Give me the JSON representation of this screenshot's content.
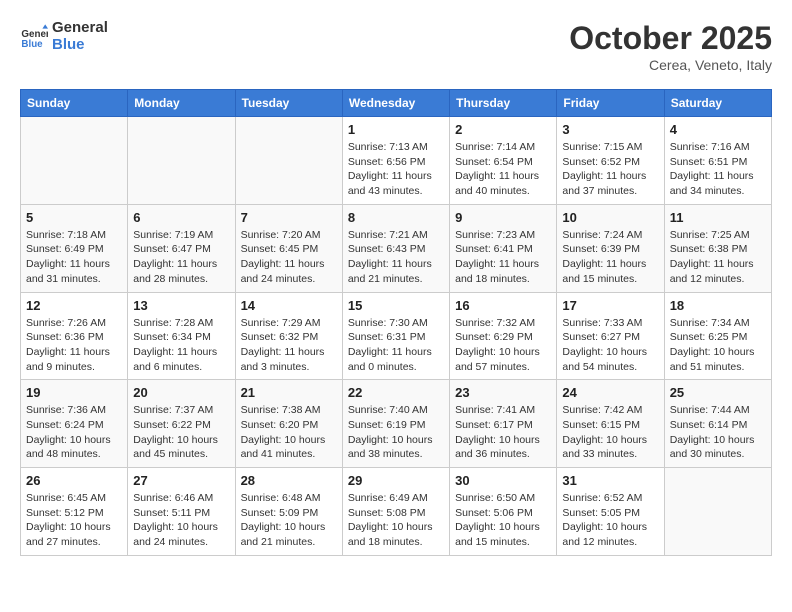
{
  "header": {
    "logo_line1": "General",
    "logo_line2": "Blue",
    "month": "October 2025",
    "location": "Cerea, Veneto, Italy"
  },
  "weekdays": [
    "Sunday",
    "Monday",
    "Tuesday",
    "Wednesday",
    "Thursday",
    "Friday",
    "Saturday"
  ],
  "weeks": [
    [
      {
        "day": "",
        "info": ""
      },
      {
        "day": "",
        "info": ""
      },
      {
        "day": "",
        "info": ""
      },
      {
        "day": "1",
        "info": "Sunrise: 7:13 AM\nSunset: 6:56 PM\nDaylight: 11 hours and 43 minutes."
      },
      {
        "day": "2",
        "info": "Sunrise: 7:14 AM\nSunset: 6:54 PM\nDaylight: 11 hours and 40 minutes."
      },
      {
        "day": "3",
        "info": "Sunrise: 7:15 AM\nSunset: 6:52 PM\nDaylight: 11 hours and 37 minutes."
      },
      {
        "day": "4",
        "info": "Sunrise: 7:16 AM\nSunset: 6:51 PM\nDaylight: 11 hours and 34 minutes."
      }
    ],
    [
      {
        "day": "5",
        "info": "Sunrise: 7:18 AM\nSunset: 6:49 PM\nDaylight: 11 hours and 31 minutes."
      },
      {
        "day": "6",
        "info": "Sunrise: 7:19 AM\nSunset: 6:47 PM\nDaylight: 11 hours and 28 minutes."
      },
      {
        "day": "7",
        "info": "Sunrise: 7:20 AM\nSunset: 6:45 PM\nDaylight: 11 hours and 24 minutes."
      },
      {
        "day": "8",
        "info": "Sunrise: 7:21 AM\nSunset: 6:43 PM\nDaylight: 11 hours and 21 minutes."
      },
      {
        "day": "9",
        "info": "Sunrise: 7:23 AM\nSunset: 6:41 PM\nDaylight: 11 hours and 18 minutes."
      },
      {
        "day": "10",
        "info": "Sunrise: 7:24 AM\nSunset: 6:39 PM\nDaylight: 11 hours and 15 minutes."
      },
      {
        "day": "11",
        "info": "Sunrise: 7:25 AM\nSunset: 6:38 PM\nDaylight: 11 hours and 12 minutes."
      }
    ],
    [
      {
        "day": "12",
        "info": "Sunrise: 7:26 AM\nSunset: 6:36 PM\nDaylight: 11 hours and 9 minutes."
      },
      {
        "day": "13",
        "info": "Sunrise: 7:28 AM\nSunset: 6:34 PM\nDaylight: 11 hours and 6 minutes."
      },
      {
        "day": "14",
        "info": "Sunrise: 7:29 AM\nSunset: 6:32 PM\nDaylight: 11 hours and 3 minutes."
      },
      {
        "day": "15",
        "info": "Sunrise: 7:30 AM\nSunset: 6:31 PM\nDaylight: 11 hours and 0 minutes."
      },
      {
        "day": "16",
        "info": "Sunrise: 7:32 AM\nSunset: 6:29 PM\nDaylight: 10 hours and 57 minutes."
      },
      {
        "day": "17",
        "info": "Sunrise: 7:33 AM\nSunset: 6:27 PM\nDaylight: 10 hours and 54 minutes."
      },
      {
        "day": "18",
        "info": "Sunrise: 7:34 AM\nSunset: 6:25 PM\nDaylight: 10 hours and 51 minutes."
      }
    ],
    [
      {
        "day": "19",
        "info": "Sunrise: 7:36 AM\nSunset: 6:24 PM\nDaylight: 10 hours and 48 minutes."
      },
      {
        "day": "20",
        "info": "Sunrise: 7:37 AM\nSunset: 6:22 PM\nDaylight: 10 hours and 45 minutes."
      },
      {
        "day": "21",
        "info": "Sunrise: 7:38 AM\nSunset: 6:20 PM\nDaylight: 10 hours and 41 minutes."
      },
      {
        "day": "22",
        "info": "Sunrise: 7:40 AM\nSunset: 6:19 PM\nDaylight: 10 hours and 38 minutes."
      },
      {
        "day": "23",
        "info": "Sunrise: 7:41 AM\nSunset: 6:17 PM\nDaylight: 10 hours and 36 minutes."
      },
      {
        "day": "24",
        "info": "Sunrise: 7:42 AM\nSunset: 6:15 PM\nDaylight: 10 hours and 33 minutes."
      },
      {
        "day": "25",
        "info": "Sunrise: 7:44 AM\nSunset: 6:14 PM\nDaylight: 10 hours and 30 minutes."
      }
    ],
    [
      {
        "day": "26",
        "info": "Sunrise: 6:45 AM\nSunset: 5:12 PM\nDaylight: 10 hours and 27 minutes."
      },
      {
        "day": "27",
        "info": "Sunrise: 6:46 AM\nSunset: 5:11 PM\nDaylight: 10 hours and 24 minutes."
      },
      {
        "day": "28",
        "info": "Sunrise: 6:48 AM\nSunset: 5:09 PM\nDaylight: 10 hours and 21 minutes."
      },
      {
        "day": "29",
        "info": "Sunrise: 6:49 AM\nSunset: 5:08 PM\nDaylight: 10 hours and 18 minutes."
      },
      {
        "day": "30",
        "info": "Sunrise: 6:50 AM\nSunset: 5:06 PM\nDaylight: 10 hours and 15 minutes."
      },
      {
        "day": "31",
        "info": "Sunrise: 6:52 AM\nSunset: 5:05 PM\nDaylight: 10 hours and 12 minutes."
      },
      {
        "day": "",
        "info": ""
      }
    ]
  ]
}
